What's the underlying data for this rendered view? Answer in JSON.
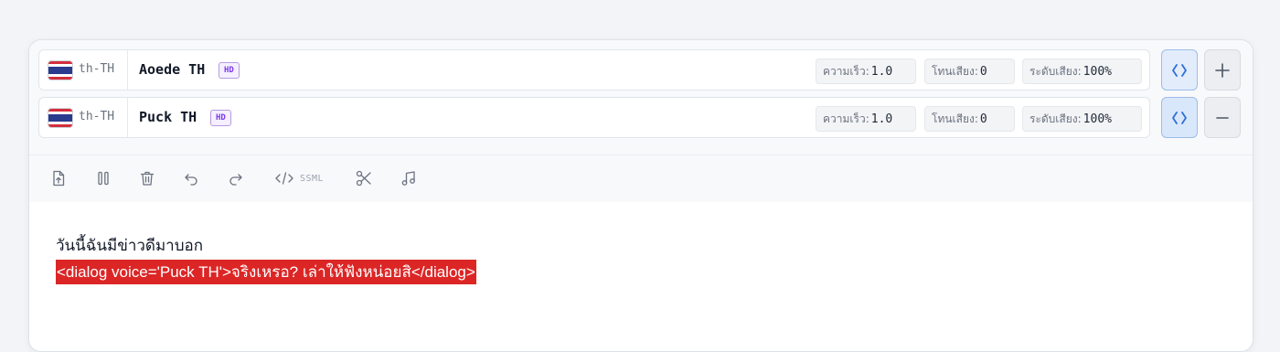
{
  "voices": [
    {
      "lang_code": "th-TH",
      "name": "Aoede TH",
      "badge": "HD",
      "speed_label": "ความเร็ว:",
      "speed_value": "1.0",
      "pitch_label": "โทนเสียง:",
      "pitch_value": "0",
      "volume_label": "ระดับเสียง:",
      "volume_value": "100%",
      "code_active": false,
      "action": "+"
    },
    {
      "lang_code": "th-TH",
      "name": "Puck TH",
      "badge": "HD",
      "speed_label": "ความเร็ว:",
      "speed_value": "1.0",
      "pitch_label": "โทนเสียง:",
      "pitch_value": "0",
      "volume_label": "ระดับเสียง:",
      "volume_value": "100%",
      "code_active": true,
      "action": "−"
    }
  ],
  "toolbar": {
    "icons": [
      "upload-file-icon",
      "pause-icon",
      "trash-icon",
      "undo-icon",
      "redo-icon",
      "ssml-code-icon",
      "scissors-icon",
      "music-note-icon"
    ],
    "ssml_label": "SSML"
  },
  "editor": {
    "line1": "วันนี้ฉันมีข่าวดีมาบอก",
    "line2": "<dialog voice='Puck TH'>จริงเหรอ? เล่าให้ฟังหน่อยสิ</dialog>"
  },
  "colors": {
    "accent": "#2f6fd6",
    "highlight": "#dc2626",
    "badge": "#7c3aed",
    "flag_red": "#d32f3c",
    "flag_white": "#ffffff",
    "flag_blue": "#2a3a8f"
  }
}
